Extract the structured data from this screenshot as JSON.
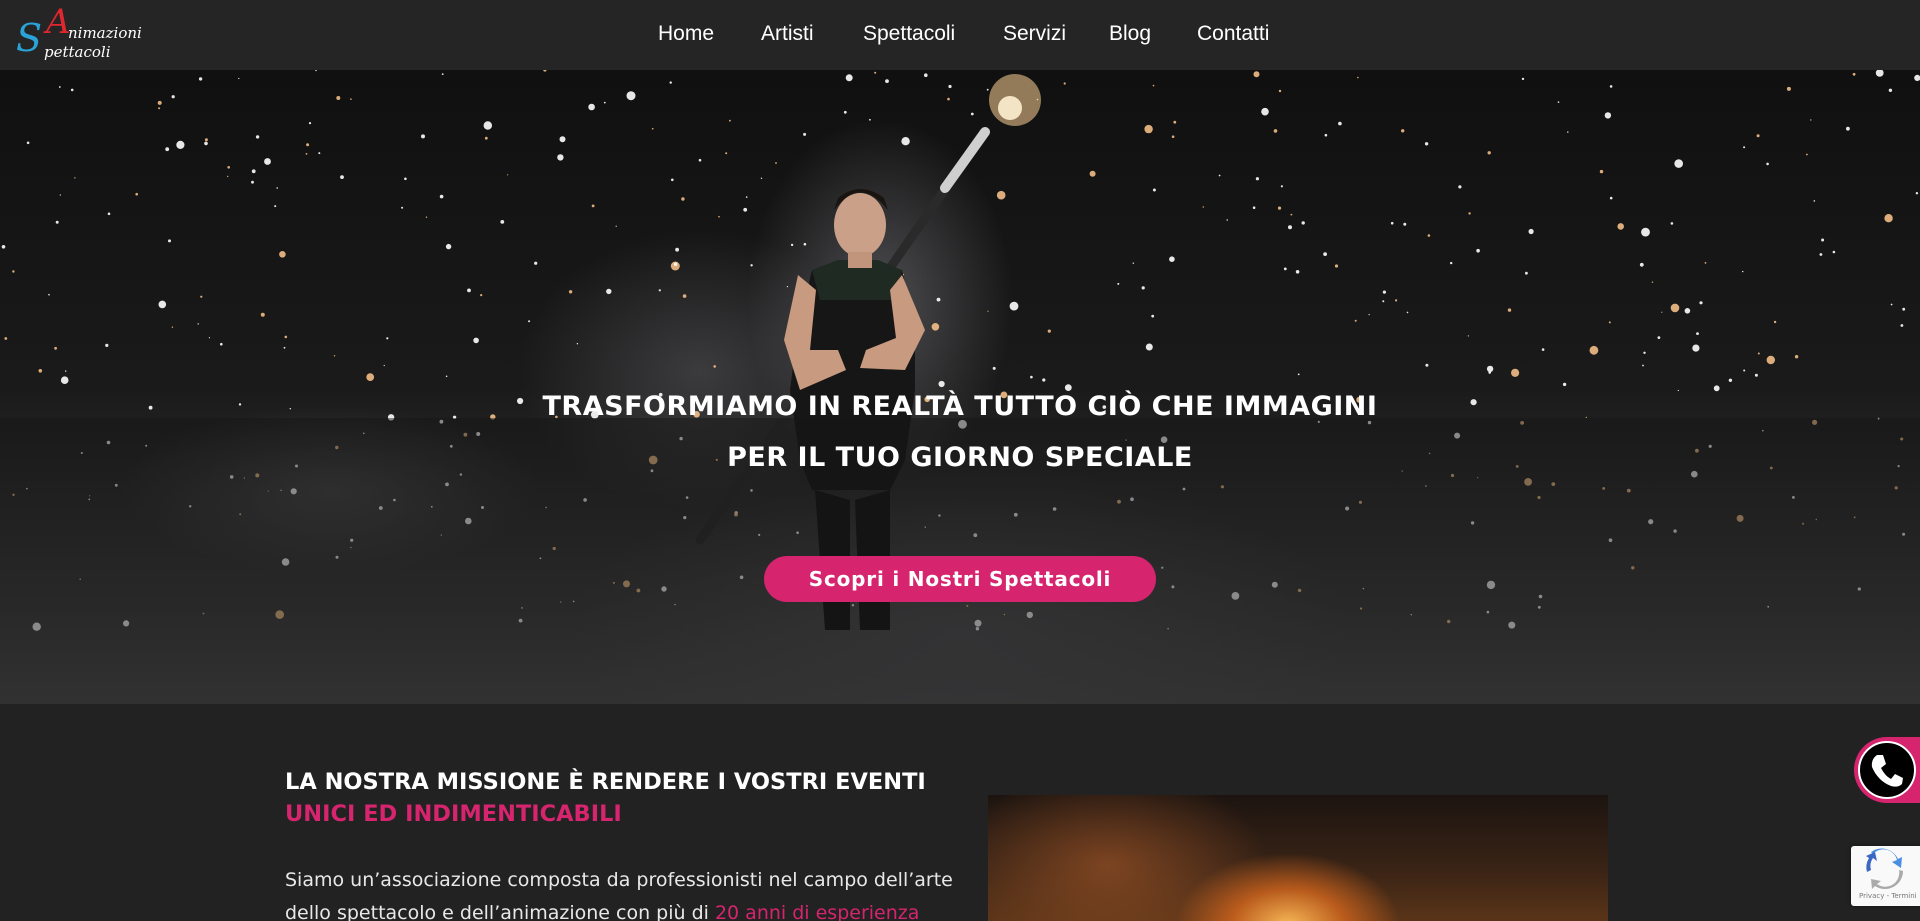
{
  "header": {
    "logo": {
      "letter_a": "A",
      "letter_s": "S",
      "word1": "nimazioni",
      "word2": "pettacoli"
    },
    "nav": [
      {
        "label": "Home"
      },
      {
        "label": "Artisti"
      },
      {
        "label": "Spettacoli"
      },
      {
        "label": "Servizi"
      },
      {
        "label": "Blog"
      },
      {
        "label": "Contatti"
      }
    ]
  },
  "hero": {
    "title_line1": "TRASFORMIAMO IN REALTÀ TUTTO CIÒ CHE IMMAGINI",
    "title_line2": "PER IL TUO GIORNO SPECIALE",
    "cta_label": "Scopri i Nostri Spettacoli"
  },
  "mission": {
    "title_main": "LA NOSTRA MISSIONE È RENDERE I VOSTRI EVENTI ",
    "title_accent": "UNICI ED INDIMENTICABILI",
    "text_main": "Siamo un’associazione composta da professionisti nel campo dell’arte dello spettacolo e dell’animazione con più di ",
    "text_accent": "20 anni di esperienza"
  },
  "recaptcha": {
    "terms": "Privacy - Termini"
  },
  "colors": {
    "accent": "#d6246e",
    "header_bg": "#252525",
    "page_bg": "#222222",
    "logo_red": "#e0262f",
    "logo_blue": "#2aa4d8"
  },
  "icons": {
    "call": "phone-icon",
    "recaptcha": "recaptcha-icon"
  }
}
